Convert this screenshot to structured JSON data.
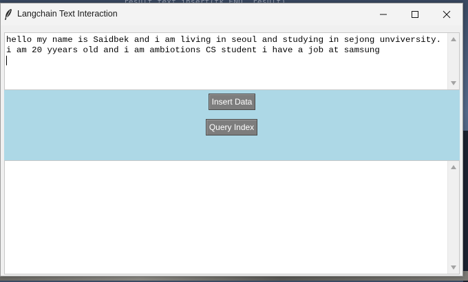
{
  "background": {
    "editor_snippet": "result_text.insert(tk.END, result)"
  },
  "window": {
    "title": "Langchain Text Interaction",
    "app_icon": "feather-icon",
    "controls": {
      "minimize_icon": "minimize-icon",
      "maximize_icon": "maximize-icon",
      "close_icon": "close-icon"
    }
  },
  "input_text": {
    "value": "hello my name is Saidbek and i am living in seoul and studying in sejong unviversity. i am 20 yyears old and i am ambiotions CS student i have a job at samsung"
  },
  "buttons": {
    "insert_label": "Insert Data",
    "query_label": "Query Index"
  },
  "output_text": {
    "value": ""
  },
  "colors": {
    "panel": "#add8e6",
    "button": "#7d7d7d",
    "button_text": "#ffffff"
  }
}
